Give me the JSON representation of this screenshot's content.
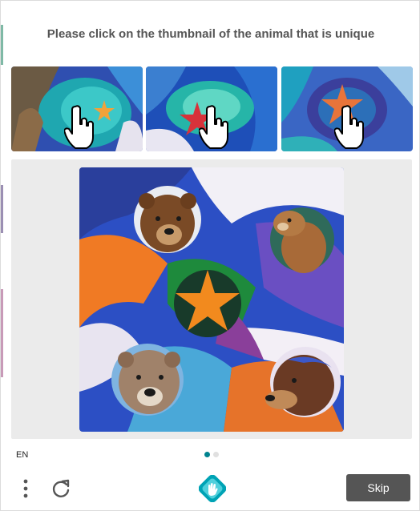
{
  "prompt": {
    "text": "Please click on the thumbnail of the animal that is unique"
  },
  "thumbnails": [
    {
      "subject": "starfish",
      "icon": "hand-cursor-icon"
    },
    {
      "subject": "starfish",
      "icon": "hand-cursor-icon"
    },
    {
      "subject": "starfish",
      "icon": "hand-cursor-icon"
    }
  ],
  "main_image": {
    "subjects": [
      "bear",
      "bear",
      "starfish",
      "bear",
      "bear"
    ]
  },
  "footer": {
    "language": "EN",
    "page_indicator": {
      "total": 2,
      "active": 1
    },
    "menu_icon": "vertical-dots-icon",
    "refresh_icon": "refresh-icon",
    "logo_icon": "hcaptcha-hand-logo",
    "skip_label": "Skip"
  },
  "colors": {
    "prompt_text": "#555555",
    "panel_bg": "#ebebeb",
    "skip_bg": "#555555",
    "dot_active": "#00838f",
    "dot_inactive": "#e0e0e0",
    "logo": "#00a3b5"
  }
}
